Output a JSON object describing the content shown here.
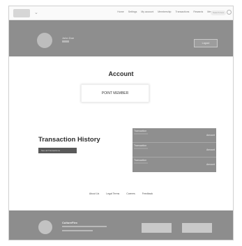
{
  "nav": {
    "caret": "⌄",
    "links": [
      "Home",
      "Settings",
      "My account",
      "Membership",
      "Transactions",
      "Rewards",
      "Menu"
    ],
    "search_placeholder": "Search here"
  },
  "header": {
    "user_name": "John Doe",
    "button_label": "Logout"
  },
  "account": {
    "title": "Account",
    "member_level": "POINT MEMBER"
  },
  "transactions": {
    "title": "Transaction History",
    "button_label": "See all Transactions",
    "rows": [
      {
        "label": "Transaction",
        "amount": "Amount"
      },
      {
        "label": "Transaction",
        "amount": "Amount"
      },
      {
        "label": "Transaction",
        "amount": "Amount"
      }
    ]
  },
  "footer_links": [
    "About Us",
    "Legal Terms",
    "Careers",
    "Feedback"
  ],
  "footer": {
    "brand": "CultureFlex"
  }
}
